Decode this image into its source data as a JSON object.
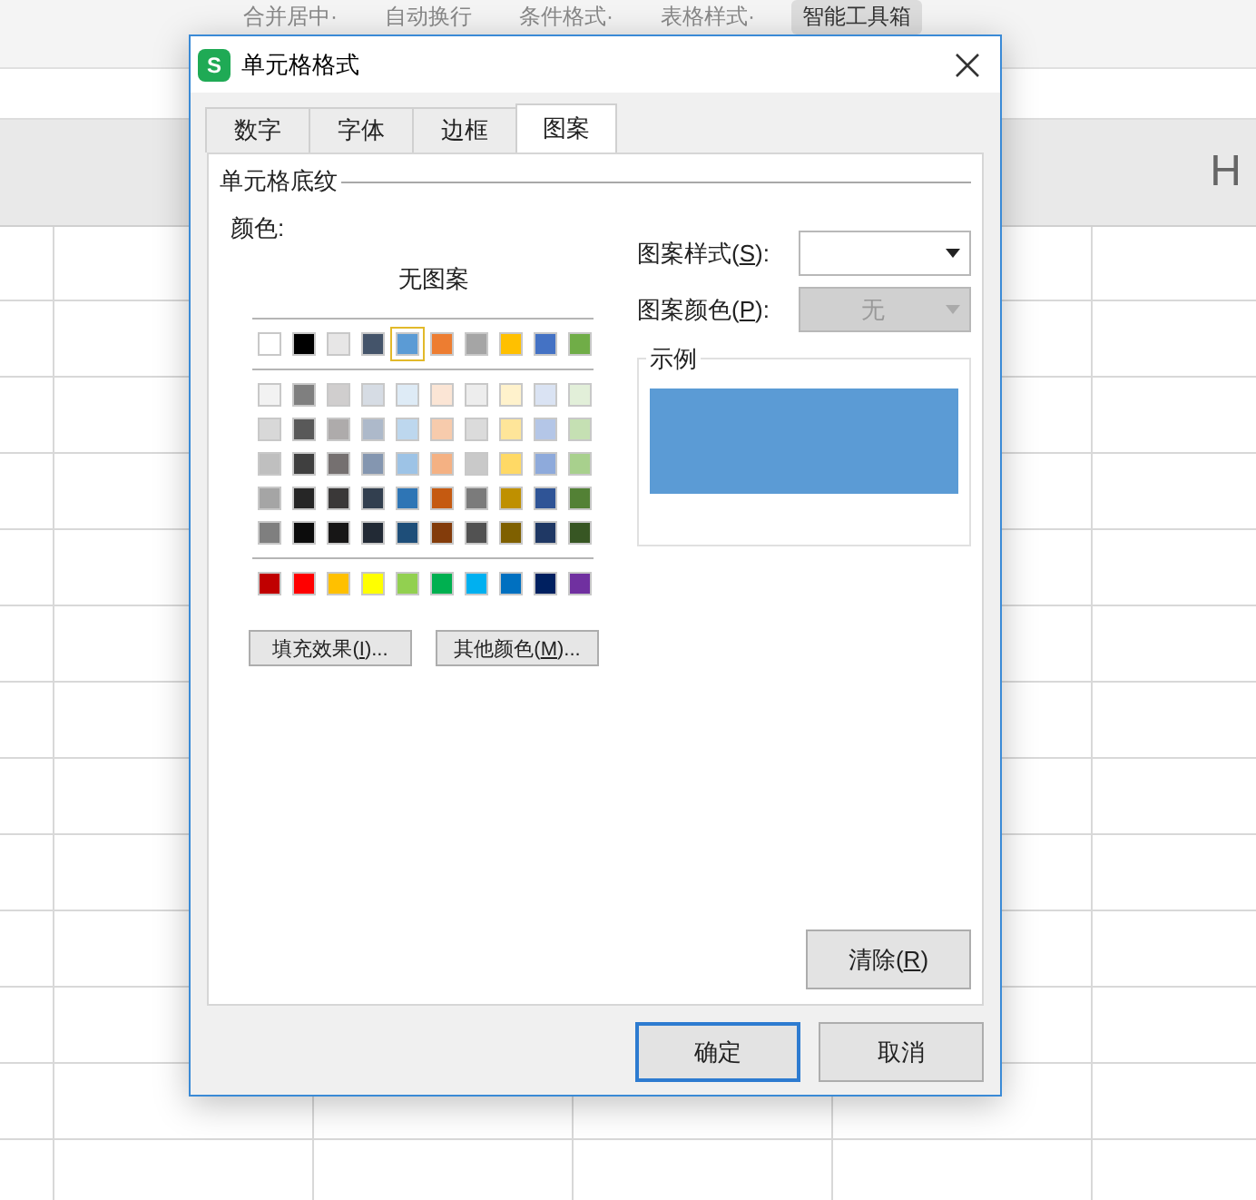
{
  "spreadsheet": {
    "toolbar": [
      {
        "label": "合并居中·"
      },
      {
        "label": "自动换行"
      },
      {
        "label": "条件格式·"
      },
      {
        "label": "表格样式·"
      },
      {
        "label": "智能工具箱",
        "kind": "button"
      }
    ],
    "column_headers": [
      "H"
    ]
  },
  "dialog": {
    "title": "单元格格式",
    "icon_text": "S",
    "tabs": [
      {
        "label": "数字",
        "selected": false
      },
      {
        "label": "字体",
        "selected": false
      },
      {
        "label": "边框",
        "selected": false
      },
      {
        "label": "图案",
        "selected": true
      }
    ],
    "section_title": "单元格底纹",
    "color_label": "颜色:",
    "no_pattern": "无图案",
    "palette": [
      [
        {
          "color": "#ffffff",
          "selected": false
        },
        {
          "color": "#000000",
          "selected": false
        },
        {
          "color": "#e7e6e6",
          "selected": false
        },
        {
          "color": "#44546a",
          "selected": false
        },
        {
          "color": "#5b9bd5",
          "selected": true
        },
        {
          "color": "#ed7d31",
          "selected": false
        },
        {
          "color": "#a5a5a5",
          "selected": false
        },
        {
          "color": "#ffc000",
          "selected": false
        },
        {
          "color": "#4472c4",
          "selected": false
        },
        {
          "color": "#70ad47",
          "selected": false
        }
      ],
      [
        {
          "color": "#f2f2f2",
          "selected": false
        },
        {
          "color": "#7f7f7f",
          "selected": false
        },
        {
          "color": "#d0cece",
          "selected": false
        },
        {
          "color": "#d6dce4",
          "selected": false
        },
        {
          "color": "#deebf6",
          "selected": false
        },
        {
          "color": "#fbe5d5",
          "selected": false
        },
        {
          "color": "#ededed",
          "selected": false
        },
        {
          "color": "#fff2cc",
          "selected": false
        },
        {
          "color": "#dae3f3",
          "selected": false
        },
        {
          "color": "#e2efd9",
          "selected": false
        },
        {
          "color": "#d8d8d8",
          "selected": false
        },
        {
          "color": "#595959",
          "selected": false
        },
        {
          "color": "#aeabab",
          "selected": false
        },
        {
          "color": "#adb9ca",
          "selected": false
        },
        {
          "color": "#bdd7ee",
          "selected": false
        },
        {
          "color": "#f7cbac",
          "selected": false
        },
        {
          "color": "#dbdbdb",
          "selected": false
        },
        {
          "color": "#fee599",
          "selected": false
        },
        {
          "color": "#b4c6e7",
          "selected": false
        },
        {
          "color": "#c5e0b3",
          "selected": false
        },
        {
          "color": "#bfbfbf",
          "selected": false
        },
        {
          "color": "#3f3f3f",
          "selected": false
        },
        {
          "color": "#757070",
          "selected": false
        },
        {
          "color": "#8496b0",
          "selected": false
        },
        {
          "color": "#9dc3e6",
          "selected": false
        },
        {
          "color": "#f4b183",
          "selected": false
        },
        {
          "color": "#c9c9c9",
          "selected": false
        },
        {
          "color": "#ffd965",
          "selected": false
        },
        {
          "color": "#8eaadb",
          "selected": false
        },
        {
          "color": "#a8d08d",
          "selected": false
        },
        {
          "color": "#a5a5a5",
          "selected": false
        },
        {
          "color": "#262626",
          "selected": false
        },
        {
          "color": "#3a3838",
          "selected": false
        },
        {
          "color": "#323f4f",
          "selected": false
        },
        {
          "color": "#2e75b5",
          "selected": false
        },
        {
          "color": "#c55a11",
          "selected": false
        },
        {
          "color": "#7b7b7b",
          "selected": false
        },
        {
          "color": "#bf9000",
          "selected": false
        },
        {
          "color": "#2f5496",
          "selected": false
        },
        {
          "color": "#538135",
          "selected": false
        },
        {
          "color": "#7f7f7f",
          "selected": false
        },
        {
          "color": "#0c0c0c",
          "selected": false
        },
        {
          "color": "#171616",
          "selected": false
        },
        {
          "color": "#222a35",
          "selected": false
        },
        {
          "color": "#1e4e79",
          "selected": false
        },
        {
          "color": "#833c0b",
          "selected": false
        },
        {
          "color": "#525252",
          "selected": false
        },
        {
          "color": "#7f6000",
          "selected": false
        },
        {
          "color": "#1f3864",
          "selected": false
        },
        {
          "color": "#375623",
          "selected": false
        }
      ],
      [
        {
          "color": "#c00000",
          "selected": false
        },
        {
          "color": "#ff0000",
          "selected": false
        },
        {
          "color": "#ffc000",
          "selected": false
        },
        {
          "color": "#ffff00",
          "selected": false
        },
        {
          "color": "#92d050",
          "selected": false
        },
        {
          "color": "#00b050",
          "selected": false
        },
        {
          "color": "#00b0f0",
          "selected": false
        },
        {
          "color": "#0070c0",
          "selected": false
        },
        {
          "color": "#002060",
          "selected": false
        },
        {
          "color": "#7030a0",
          "selected": false
        }
      ]
    ],
    "left_buttons": [
      {
        "parts": [
          "填充效果(",
          "I",
          ")..."
        ]
      },
      {
        "parts": [
          "其他颜色(",
          "M",
          ")..."
        ]
      }
    ],
    "fields": [
      {
        "parts": [
          "图案样式(",
          "S",
          "):"
        ],
        "disabled": false
      },
      {
        "parts": [
          "图案颜色(",
          "P",
          "):"
        ],
        "value": "无",
        "disabled": true
      }
    ],
    "sample_label": "示例",
    "clear_button": {
      "parts": [
        "清除(",
        "R",
        ")"
      ]
    },
    "buttons": [
      {
        "label": "确定",
        "default": true
      },
      {
        "label": "取消",
        "default": false
      }
    ]
  }
}
